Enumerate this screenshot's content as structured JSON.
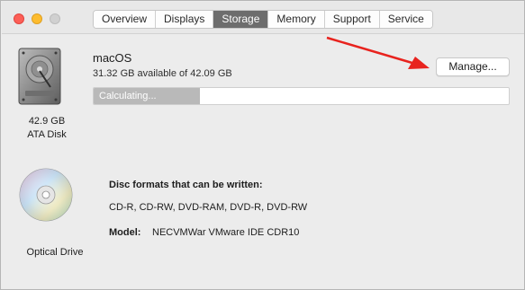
{
  "window": {
    "tabs": [
      "Overview",
      "Displays",
      "Storage",
      "Memory",
      "Support",
      "Service"
    ],
    "active_tab": "Storage"
  },
  "disk": {
    "icon": "hard-drive-icon",
    "size": "42.9 GB",
    "kind": "ATA Disk",
    "volume_name": "macOS",
    "available_text": "31.32 GB available of 42.09 GB",
    "progress_text": "Calculating...",
    "progress_fraction": 0.255,
    "manage_label": "Manage..."
  },
  "optical": {
    "icon": "optical-disc-icon",
    "label": "Optical Drive",
    "formats_title": "Disc formats that can be written:",
    "formats": "CD-R, CD-RW, DVD-RAM, DVD-R, DVD-RW",
    "model_label": "Model:",
    "model_value": "NECVMWar VMware IDE CDR10"
  },
  "annotation": {
    "arrow_color": "#e8231e"
  },
  "colors": {
    "active_tab": "#6d6d6d",
    "progress_fill": "#b9b9b9"
  }
}
